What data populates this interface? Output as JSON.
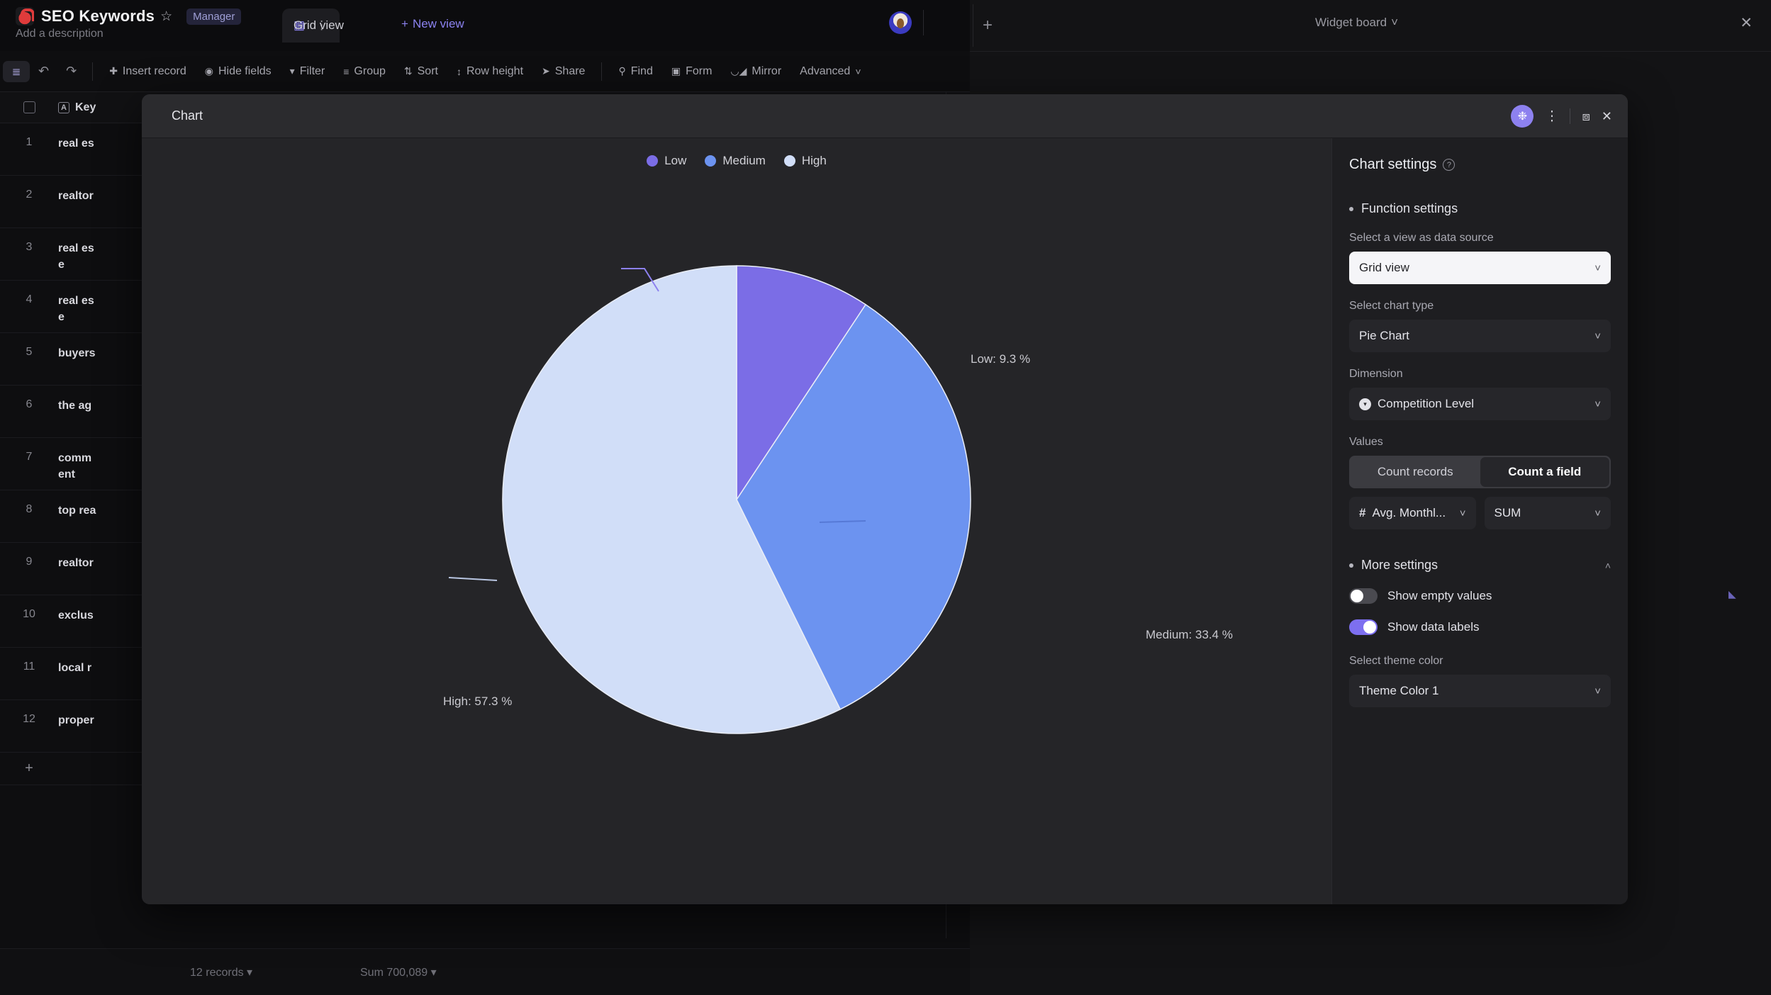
{
  "app": {
    "brand": {
      "title": "SEO Keywords",
      "star_icon": "star-icon",
      "badge": "Manager",
      "description": "Add a description"
    },
    "view_tab": {
      "icon": "grid-icon",
      "label": "Grid view",
      "menu": "⋮"
    },
    "new_view": {
      "label": "New view",
      "icon": "plus-icon"
    },
    "toolbar": {
      "sidebar_toggle": "sidebar-toggle-icon",
      "undo": "undo-icon",
      "redo": "redo-icon",
      "items": [
        {
          "icon": "plus-circle-icon",
          "label": "Insert record"
        },
        {
          "icon": "eye-off-icon",
          "label": "Hide fields"
        },
        {
          "icon": "funnel-icon",
          "label": "Filter"
        },
        {
          "icon": "group-icon",
          "label": "Group"
        },
        {
          "icon": "sort-icon",
          "label": "Sort"
        },
        {
          "icon": "row-height-icon",
          "label": "Row height"
        },
        {
          "icon": "share-icon",
          "label": "Share"
        },
        {
          "icon": "search-icon",
          "label": "Find"
        },
        {
          "icon": "form-icon",
          "label": "Form"
        },
        {
          "icon": "mirror-icon",
          "label": "Mirror"
        },
        {
          "icon": "chevron-down-icon",
          "label": "Advanced"
        }
      ]
    },
    "grid": {
      "column_header": {
        "field_icon": "A",
        "label": "Key"
      },
      "rows": [
        {
          "index": "1",
          "value": "real es"
        },
        {
          "index": "2",
          "value": "realtor"
        },
        {
          "index": "3",
          "value": "real es\ne"
        },
        {
          "index": "4",
          "value": "real es\ne"
        },
        {
          "index": "5",
          "value": "buyers"
        },
        {
          "index": "6",
          "value": "the ag"
        },
        {
          "index": "7",
          "value": "comm\nent"
        },
        {
          "index": "8",
          "value": "top rea"
        },
        {
          "index": "9",
          "value": "realtor"
        },
        {
          "index": "10",
          "value": "exclus"
        },
        {
          "index": "11",
          "value": "local r"
        },
        {
          "index": "12",
          "value": "proper"
        }
      ],
      "add_row_icon": "plus-icon"
    },
    "status_bar": {
      "records": "12 records ▾",
      "sum": "Sum 700,089 ▾"
    },
    "widget_board": {
      "add_icon": "plus-icon",
      "title": "Widget board",
      "title_chevron": "chevron-down-icon",
      "close_icon": "close-icon",
      "resize_handle": "resize-handle-icon"
    }
  },
  "modal": {
    "title": "Chart",
    "actions": {
      "settings_icon": "gear-icon",
      "more_icon": "more-vertical-icon",
      "expand_icon": "expand-icon",
      "close_icon": "close-icon"
    }
  },
  "chart_data": {
    "type": "pie",
    "title": "",
    "categories": [
      "Low",
      "Medium",
      "High"
    ],
    "values": [
      9.3,
      33.4,
      57.3
    ],
    "value_unit": "%",
    "labels": [
      "Low: 9.3 %",
      "Medium: 33.4 %",
      "High: 57.3 %"
    ],
    "colors": [
      "#7B6DE6",
      "#6C93F0",
      "#D1DEF8"
    ],
    "legend": [
      "Low",
      "Medium",
      "High"
    ],
    "legend_position": "top",
    "grid": false,
    "dimension": "Competition Level",
    "measure": "Avg. Monthl...",
    "aggregation": "SUM",
    "data_labels": true
  },
  "settings": {
    "heading": "Chart settings",
    "help_icon": "help-circle-icon",
    "function_settings": {
      "label": "Function settings",
      "bullet": "bullet-icon"
    },
    "data_source": {
      "label": "Select a view as data source",
      "value": "Grid view",
      "chevron": "chevron-down-icon"
    },
    "chart_type": {
      "label": "Select chart type",
      "value": "Pie Chart",
      "chevron": "chevron-down-icon"
    },
    "dimension": {
      "label": "Dimension",
      "field_icon": "single-select-icon",
      "value": "Competition Level",
      "chevron": "chevron-down-icon"
    },
    "values": {
      "label": "Values",
      "segments": [
        "Count records",
        "Count a field"
      ],
      "active_segment": "Count a field",
      "field": {
        "icon": "number-icon",
        "value": "Avg. Monthl...",
        "chevron": "chevron-down-icon"
      },
      "aggregation": {
        "value": "SUM",
        "chevron": "chevron-down-icon"
      }
    },
    "more_settings": {
      "label": "More settings",
      "bullet": "bullet-icon",
      "chevron": "chevron-up-icon"
    },
    "toggles": [
      {
        "label": "Show empty values",
        "state": "off"
      },
      {
        "label": "Show data labels",
        "state": "on"
      }
    ],
    "theme": {
      "label": "Select theme color",
      "value": "Theme Color 1",
      "chevron": "chevron-down-icon"
    }
  },
  "colors": {
    "accent": "#7D6FF0",
    "low": "#7B6DE6",
    "medium": "#6C93F0",
    "high": "#D1DEF8"
  }
}
